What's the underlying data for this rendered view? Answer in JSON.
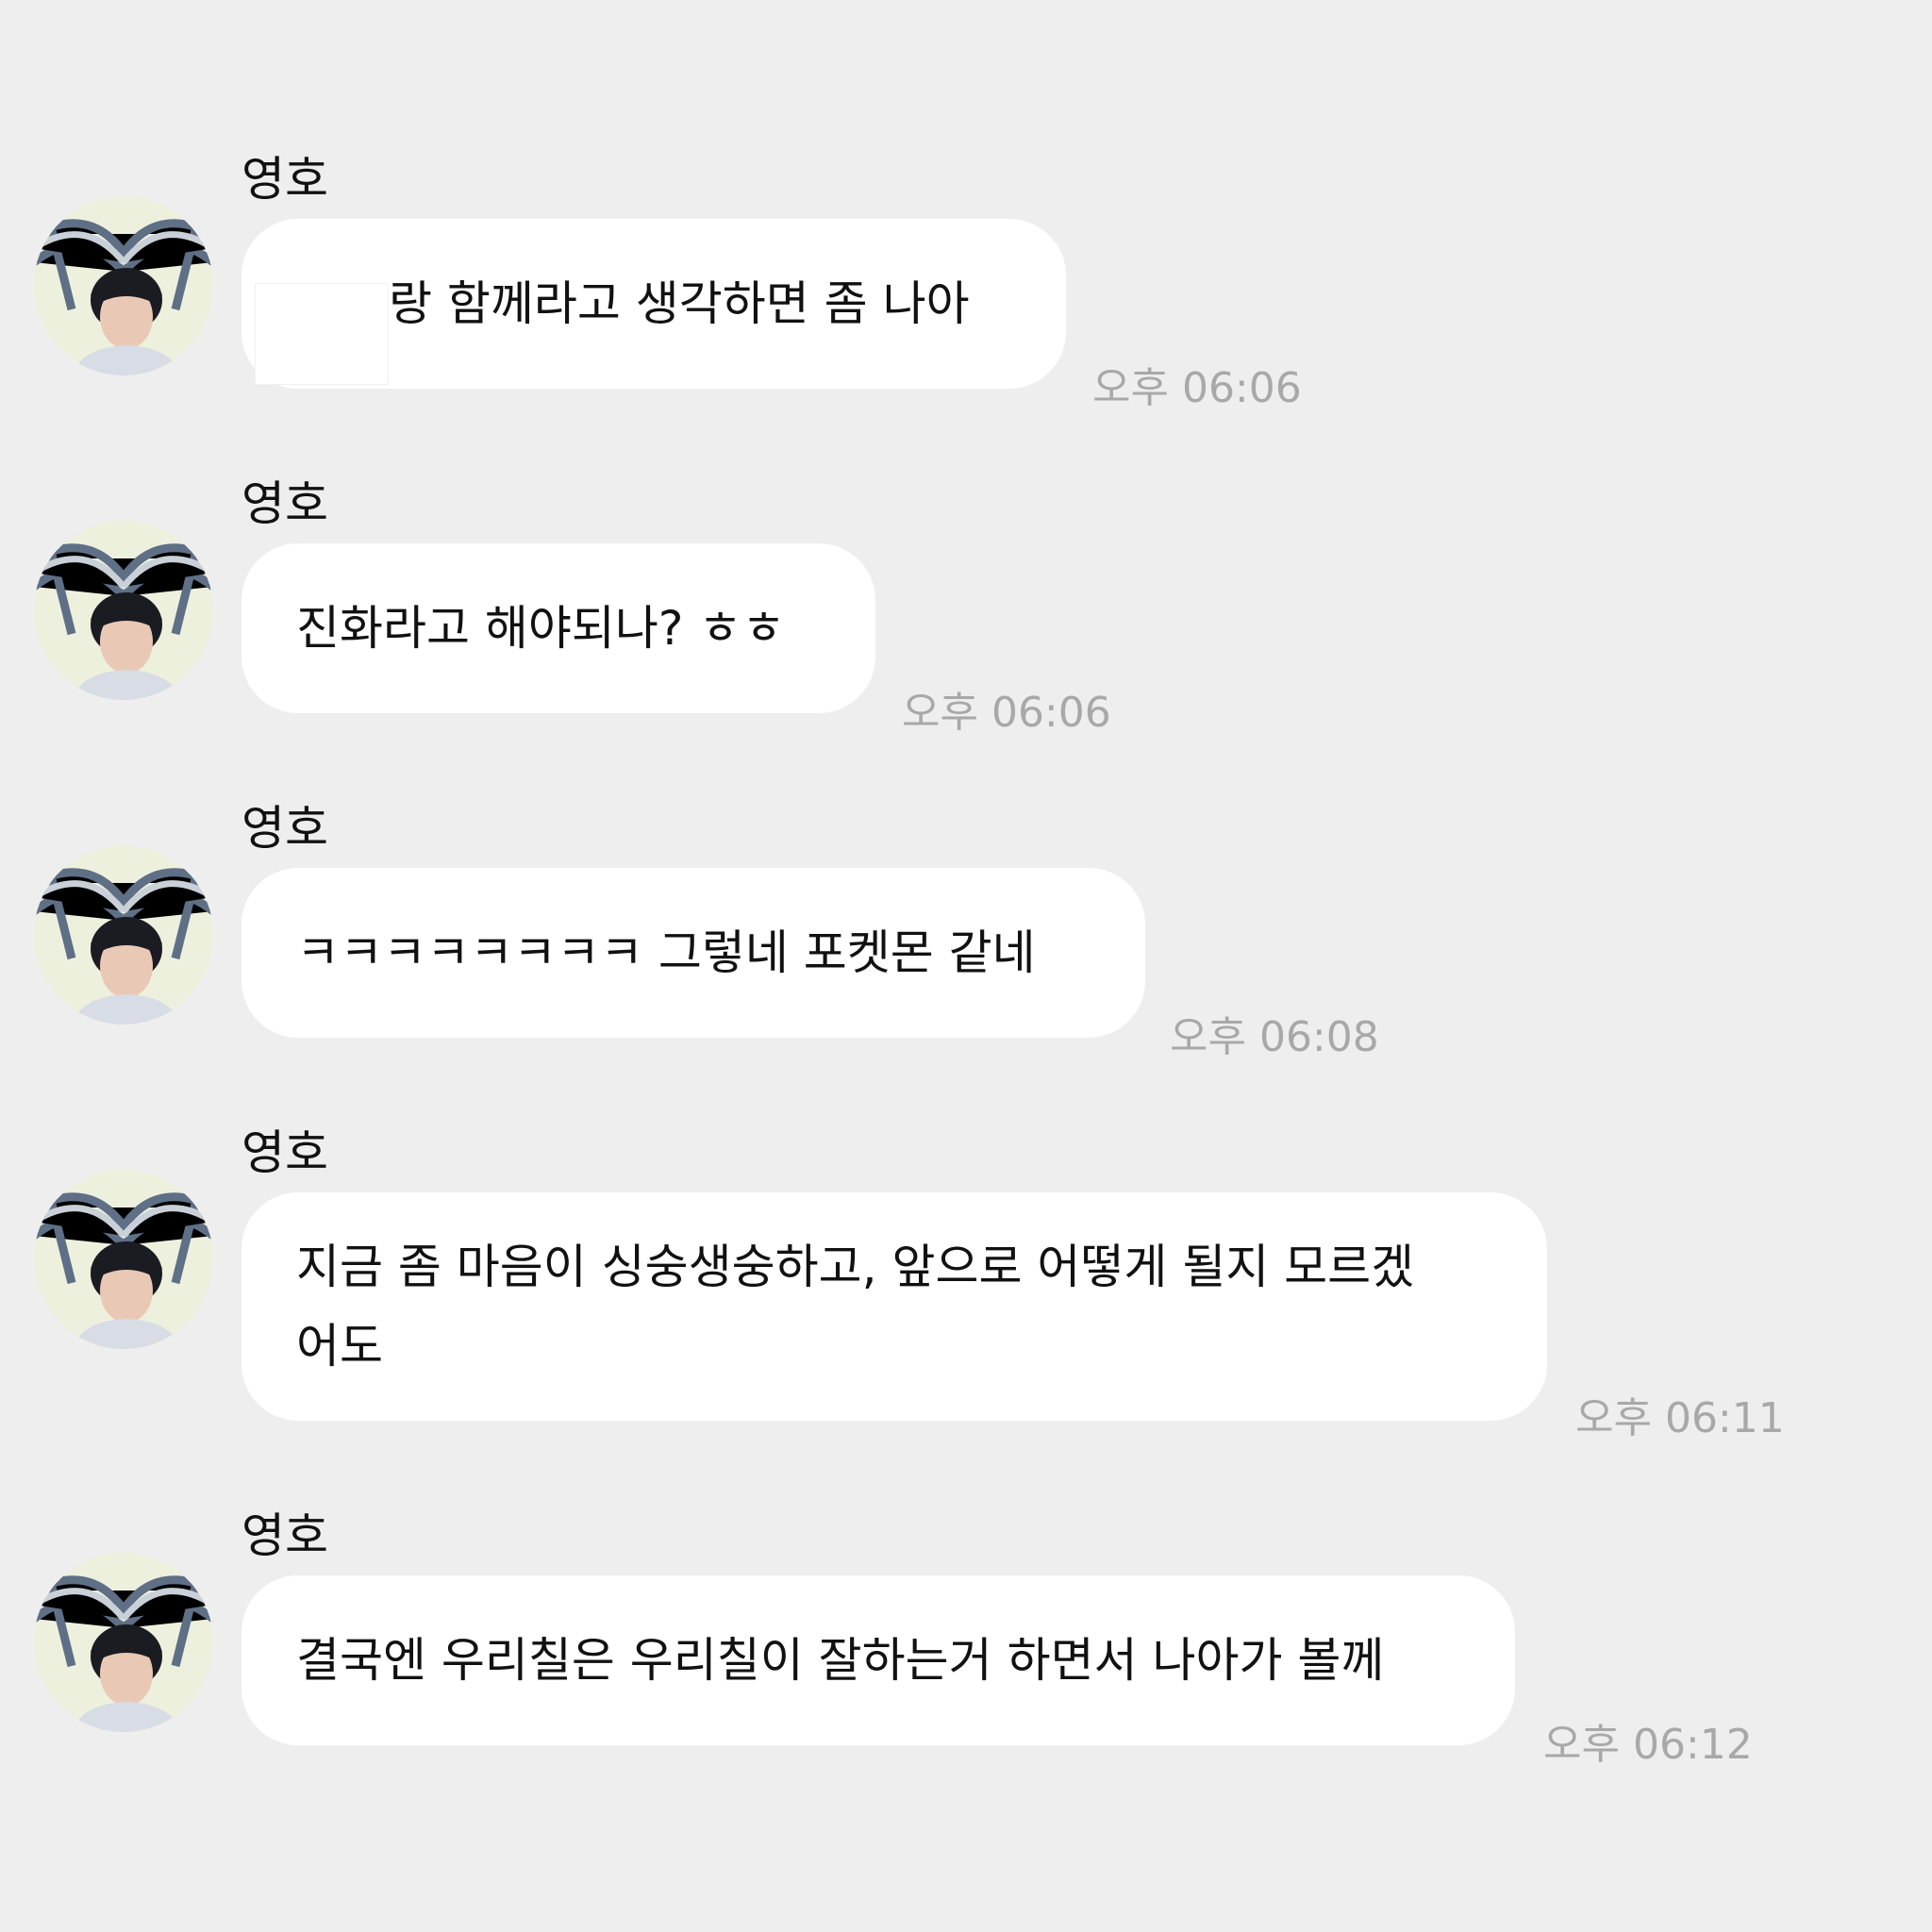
{
  "sender_name": "영호",
  "messages": [
    {
      "text": "랑 함께라고 생각하면 좀 나아",
      "time": "오후 06:06"
    },
    {
      "text": "진화라고 해야되나? ㅎㅎ",
      "time": "오후 06:06"
    },
    {
      "text": "ㅋㅋㅋㅋㅋㅋㅋㅋ 그렇네 포켓몬 같네",
      "time": "오후 06:08"
    },
    {
      "text": "지금 좀 마음이 싱숭생숭하고, 앞으로 어떻게 될지 모르겠\n어도",
      "time": "오후 06:11"
    },
    {
      "text": "결국엔 우리칠은 우리칠이 잘하는거 하면서 나아가 볼께",
      "time": "오후 06:12"
    }
  ]
}
